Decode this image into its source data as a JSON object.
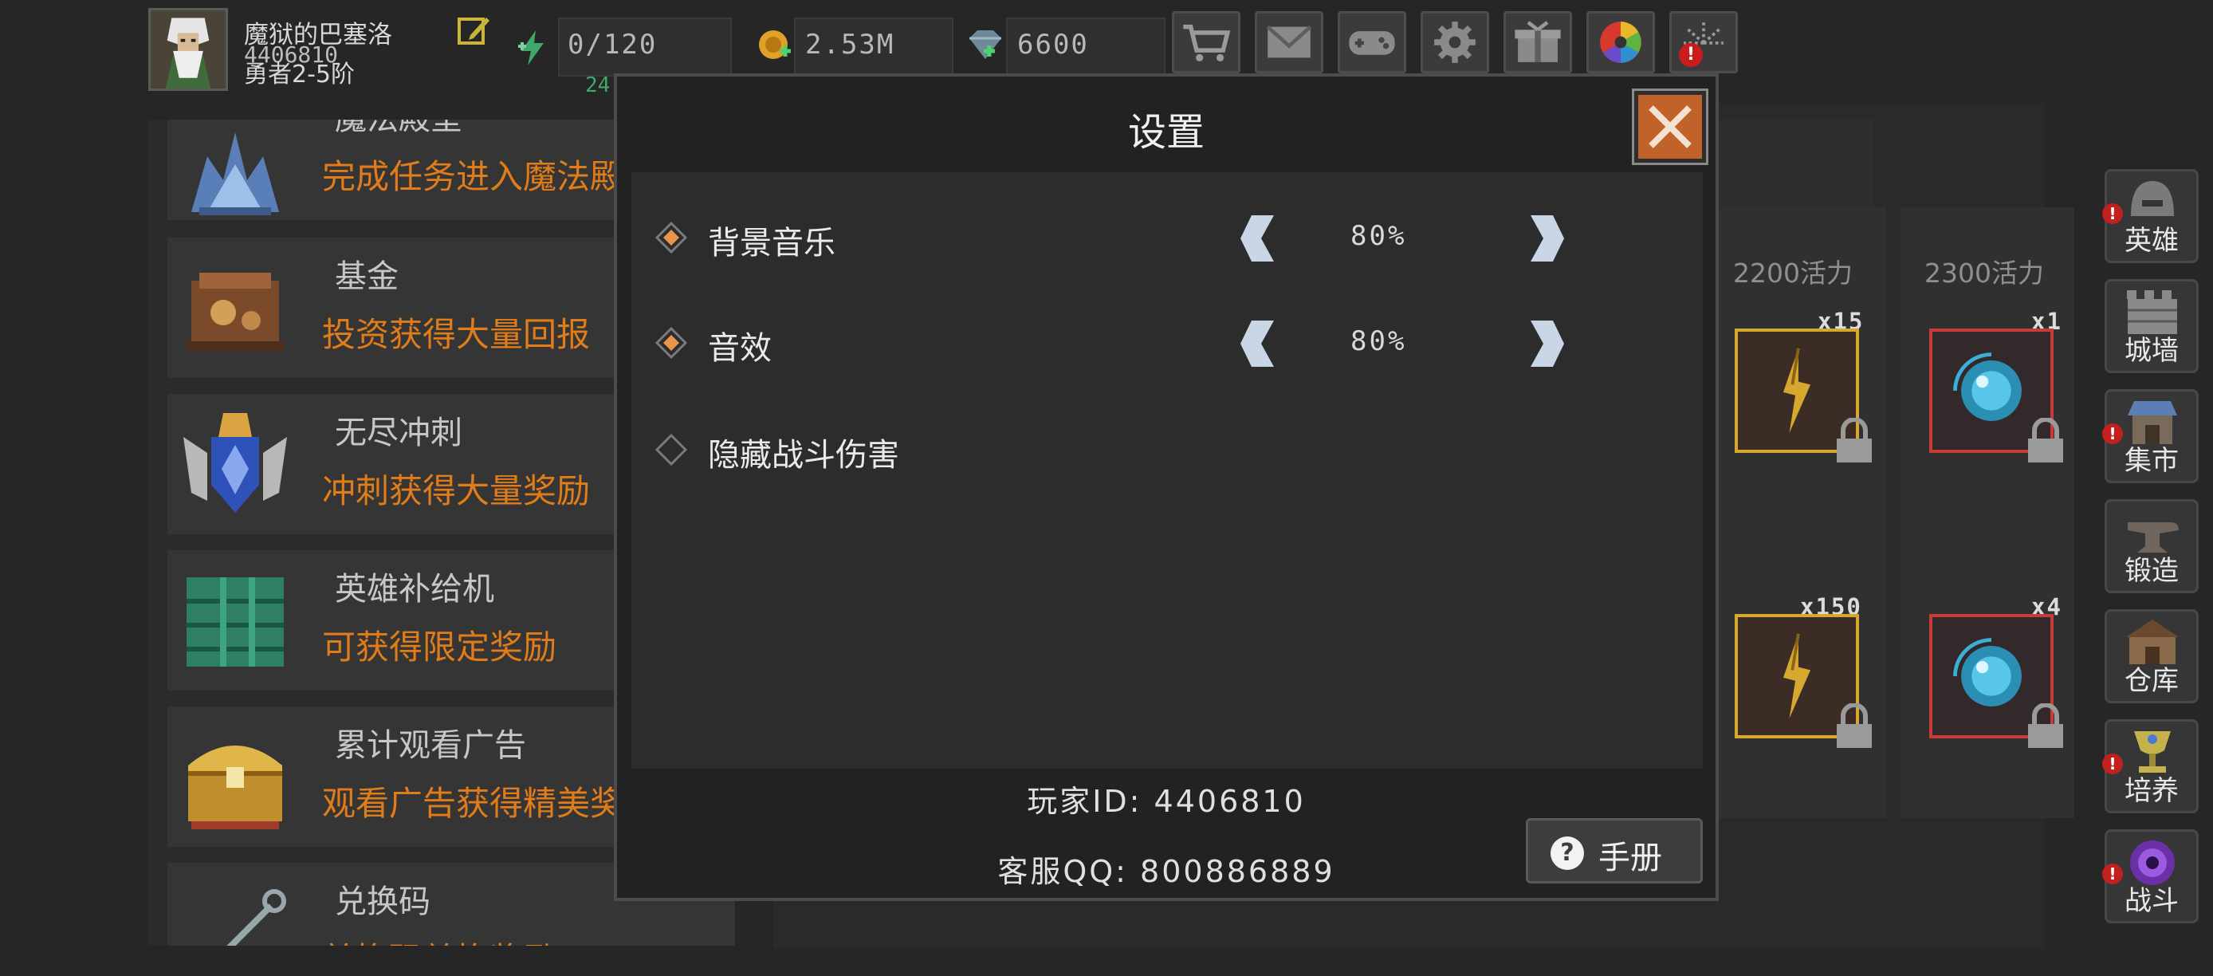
{
  "player": {
    "name": "魔狱的巴塞洛",
    "id": "4406810",
    "rank": "勇者2-5阶"
  },
  "resources": {
    "energy": "0/120",
    "energy_timer": "24",
    "gold": "2.53M",
    "gems": "6600"
  },
  "top_buttons": [
    "shop",
    "mail",
    "gamepad",
    "settings",
    "gift",
    "wheel",
    "fireworks"
  ],
  "events": [
    {
      "title": "魔法殿堂",
      "desc": "完成任务进入魔法殿堂"
    },
    {
      "title": "基金",
      "desc": "投资获得大量回报"
    },
    {
      "title": "无尽冲刺",
      "desc": "冲刺获得大量奖励"
    },
    {
      "title": "英雄补给机",
      "desc": "可获得限定奖励"
    },
    {
      "title": "累计观看广告",
      "desc": "观看广告获得精美奖励"
    },
    {
      "title": "兑换码",
      "desc": "兑换码兑换奖励"
    }
  ],
  "shop": {
    "columns": [
      {
        "header": "2200活力",
        "items": [
          {
            "count": "x15",
            "type": "feather"
          },
          {
            "count": "x150",
            "type": "feather"
          }
        ]
      },
      {
        "header": "2300活力",
        "items": [
          {
            "count": "x1",
            "type": "orb"
          },
          {
            "count": "x4",
            "type": "orb"
          }
        ]
      }
    ]
  },
  "sidebar": [
    {
      "label": "英雄",
      "badge": true
    },
    {
      "label": "城墙",
      "badge": false
    },
    {
      "label": "集市",
      "badge": true
    },
    {
      "label": "锻造",
      "badge": false
    },
    {
      "label": "仓库",
      "badge": false
    },
    {
      "label": "培养",
      "badge": true
    },
    {
      "label": "战斗",
      "badge": true
    }
  ],
  "badge_mark": "!",
  "settings": {
    "title": "设置",
    "options": [
      {
        "label": "背景音乐",
        "value": "80%",
        "checked": true
      },
      {
        "label": "音效",
        "value": "80%",
        "checked": true
      },
      {
        "label": "隐藏战斗伤害",
        "checked": false
      }
    ],
    "player_id_line": "玩家ID: 4406810",
    "support_line": "客服QQ: 800886889",
    "manual_label": "手册",
    "manual_icon": "?"
  },
  "colors": {
    "accent_orange": "#e07c1a",
    "close_button": "#c2622b",
    "checked_diamond": "#e8944a",
    "gold_border": "#d6a92e",
    "red_border": "#c83b3b"
  }
}
